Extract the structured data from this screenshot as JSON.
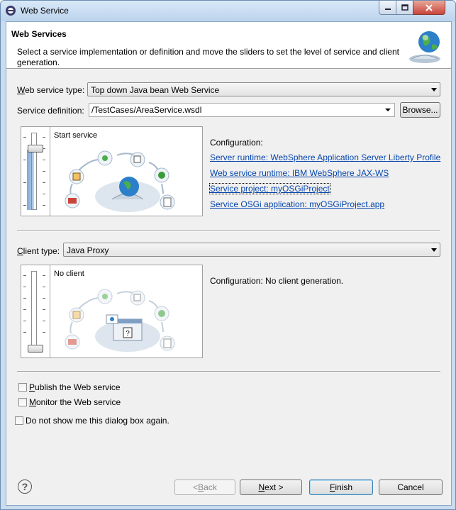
{
  "window": {
    "title": "Web Service",
    "controls": {
      "minimize": "minimize",
      "maximize": "maximize",
      "close": "close"
    }
  },
  "header": {
    "title": "Web Services",
    "description": "Select a service implementation or definition and move the sliders to set the level of service and client generation."
  },
  "service": {
    "type_label_prefix": "W",
    "type_label_rest": "eb service type:",
    "type_value": "Top down Java bean Web Service",
    "definition_label": "Service definition:",
    "definition_value": "/TestCases/AreaService.wsdl",
    "browse_label": "Browse...",
    "slider_level": "Start service",
    "configuration_label": "Configuration:",
    "links": [
      "Server runtime: WebSphere Application Server Liberty Profile",
      "Web service runtime: IBM WebSphere JAX-WS",
      "Service project: myOSGiProject",
      "Service OSGi application: myOSGiProject.app"
    ]
  },
  "client": {
    "type_label_prefix": "C",
    "type_label_rest": "lient type:",
    "type_value": "Java Proxy",
    "slider_level": "No client",
    "configuration_text": "Configuration: No client generation."
  },
  "options": {
    "publish": {
      "prefix": "P",
      "rest": "ublish the Web service",
      "checked": false
    },
    "monitor": {
      "prefix": "M",
      "rest": "onitor the Web service",
      "checked": false
    },
    "dont_show": {
      "label": "Do not show me this dialog box again.",
      "checked": false
    }
  },
  "buttons": {
    "help": "?",
    "back_pre": "< ",
    "back_u": "B",
    "back_post": "ack",
    "next_pre": "",
    "next_u": "N",
    "next_post": "ext >",
    "finish_pre": "",
    "finish_u": "F",
    "finish_post": "inish",
    "cancel": "Cancel"
  },
  "colors": {
    "accent": "#0645ad",
    "title_bar": "#c9dcf0",
    "client_bg": "#f0f0f0"
  }
}
